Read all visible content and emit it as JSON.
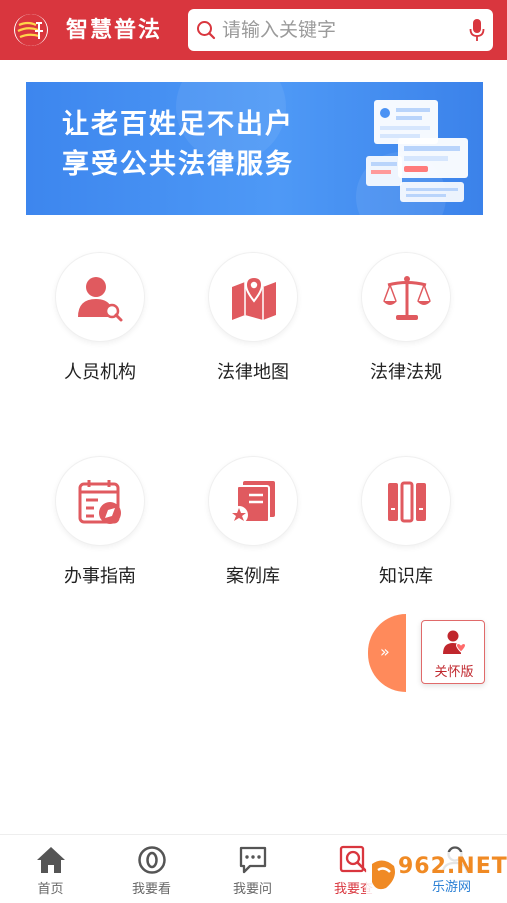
{
  "header": {
    "app_title": "智慧普法",
    "search_placeholder": "请输入关键字",
    "logo_icon": "fa-law-logo",
    "search_icon": "search-icon",
    "mic_icon": "microphone-icon"
  },
  "banner": {
    "line1": "让老百姓足不出户",
    "line2": "享受公共法律服务"
  },
  "grid": [
    {
      "label": "人员机构",
      "icon": "person-search-icon"
    },
    {
      "label": "法律地图",
      "icon": "map-pin-icon"
    },
    {
      "label": "法律法规",
      "icon": "scales-icon"
    },
    {
      "label": "办事指南",
      "icon": "calendar-compass-icon"
    },
    {
      "label": "案例库",
      "icon": "case-book-icon"
    },
    {
      "label": "知识库",
      "icon": "bookshelf-icon"
    }
  ],
  "floating": {
    "expand_symbol": "»",
    "care_label": "关怀版"
  },
  "bottom_nav": [
    {
      "label": "首页",
      "icon": "home-icon",
      "active": false
    },
    {
      "label": "我要看",
      "icon": "eye-icon",
      "active": false
    },
    {
      "label": "我要问",
      "icon": "chat-icon",
      "active": false
    },
    {
      "label": "我要查",
      "icon": "search-doc-icon",
      "active": true
    },
    {
      "label": "",
      "icon": "user-icon",
      "active": false
    }
  ],
  "watermark": {
    "main": "962.NET",
    "sub": "乐游网"
  },
  "colors": {
    "brand_red": "#d9363e",
    "icon_red": "#e05a5f",
    "banner_blue": "#4a92f4",
    "float_orange": "#ff8a5b"
  }
}
